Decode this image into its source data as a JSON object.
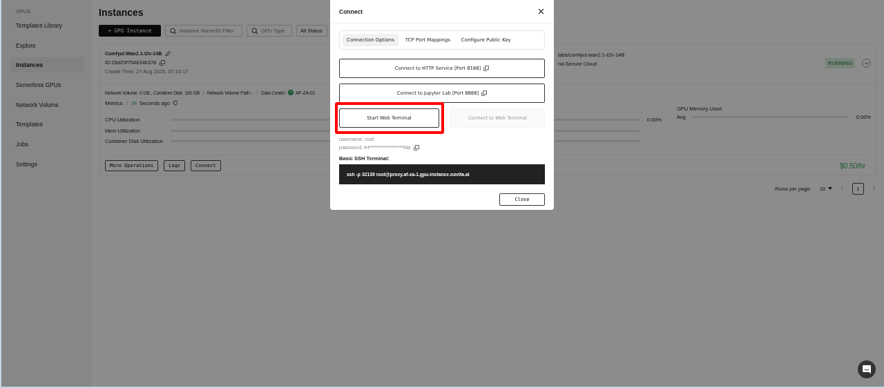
{
  "sidebar": {
    "section": "GPUS",
    "items": [
      {
        "label": "Templates Library",
        "selected": false
      },
      {
        "label": "Explore",
        "selected": false
      },
      {
        "label": "Instances",
        "selected": true
      },
      {
        "label": "Serverless GPUs",
        "selected": false
      },
      {
        "label": "Network Volume",
        "selected": false
      },
      {
        "label": "Templates",
        "selected": false
      },
      {
        "label": "Jobs",
        "selected": false
      },
      {
        "label": "Settings",
        "selected": false
      }
    ]
  },
  "page": {
    "title": "Instances",
    "new_button": "+ GPU Instance",
    "filters": [
      {
        "kind": "search",
        "placeholder": "Instance Name/ID Filter"
      },
      {
        "kind": "search",
        "placeholder": "GPU Type"
      },
      {
        "kind": "select",
        "value": "All Status"
      }
    ]
  },
  "instance": {
    "name": "Comfyui:Wan2.1-t2v-14B",
    "id": "ID:28d29f754834b376",
    "create_time": "Create Time: 27 Aug 2025, 07:14:17",
    "image_fragment": "labs/comfyui:wan2.1-t2v-14B",
    "cloud_fragment": "nd-Secure Cloud",
    "status": "RUNNING",
    "details": [
      "Network Volume: 0 GB , Container Disk: 100 GB",
      "Network Volume Path: -"
    ],
    "data_center_label": "Data Center:",
    "data_center": "AF-ZA-01",
    "metrics_label": "Metrics",
    "metrics_age": "54",
    "metrics_age_unit": "Seconds ago",
    "metrics": [
      {
        "name": "CPU Utilization",
        "level": 0,
        "reading": "0.00%"
      },
      {
        "name": "Mem Utilization",
        "level": 0
      },
      {
        "name": "Container Disk Utilization",
        "level": 0
      }
    ],
    "gpu_memory": {
      "title": "GPU Memory Used",
      "name": "Avg",
      "level": 0,
      "reading": "0.00%"
    },
    "actions": [
      "More Operations",
      "Logs",
      "Connect"
    ],
    "price": "$0.50/hr"
  },
  "pagination": {
    "label": "Rows per page:",
    "rows": "10",
    "page": "1"
  },
  "dialog": {
    "title": "Connect",
    "tabs": [
      {
        "label": "Connection Options",
        "selected": true
      },
      {
        "label": "TCP Port Mappings",
        "selected": false
      },
      {
        "label": "Configure Public Key",
        "selected": false
      }
    ],
    "links": [
      "Connect to HTTP Service [Port 8188]",
      "Connect to Jupyter Lab [Port 8888]"
    ],
    "terminal_buttons": [
      {
        "label": "Start Web Terminal",
        "disabled": false,
        "highlighted": true
      },
      {
        "label": "Connect to Web Terminal",
        "disabled": true,
        "highlighted": false
      }
    ],
    "username": "username: root",
    "password": "password: iH*****************Ma",
    "ssh_label": "Basic SSH Terminal:",
    "ssh_command": "ssh -p 32139 root@proxy.af-za-1.gpu-instance.novita.ai",
    "close": "Close"
  }
}
